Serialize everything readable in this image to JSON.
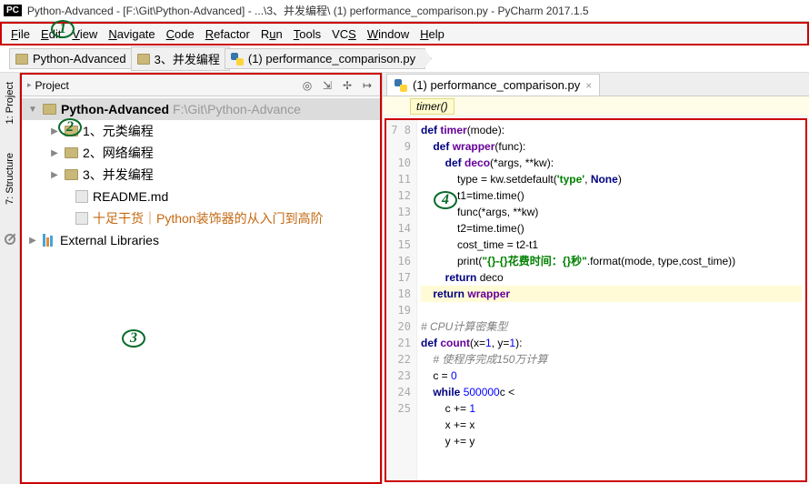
{
  "window": {
    "badge": "PC",
    "title": "Python-Advanced - [F:\\Git\\Python-Advanced] - ...\\3、并发编程\\ (1) performance_comparison.py - PyCharm 2017.1.5"
  },
  "menu": {
    "items": [
      {
        "pre": "",
        "u": "F",
        "rest": "ile"
      },
      {
        "pre": "",
        "u": "E",
        "rest": "dit"
      },
      {
        "pre": "",
        "u": "V",
        "rest": "iew"
      },
      {
        "pre": "",
        "u": "N",
        "rest": "avigate"
      },
      {
        "pre": "",
        "u": "C",
        "rest": "ode"
      },
      {
        "pre": "",
        "u": "R",
        "rest": "efactor"
      },
      {
        "pre": "R",
        "u": "u",
        "rest": "n"
      },
      {
        "pre": "",
        "u": "T",
        "rest": "ools"
      },
      {
        "pre": "VC",
        "u": "S",
        "rest": ""
      },
      {
        "pre": "",
        "u": "W",
        "rest": "indow"
      },
      {
        "pre": "",
        "u": "H",
        "rest": "elp"
      }
    ]
  },
  "breadcrumb": [
    {
      "type": "folder",
      "text": "Python-Advanced"
    },
    {
      "type": "folder",
      "text": "3、并发编程"
    },
    {
      "type": "py",
      "text": "(1) performance_comparison.py"
    }
  ],
  "side_tabs": {
    "project": "1: Project",
    "structure": "7: Structure"
  },
  "project_header": {
    "title": "Project"
  },
  "tree": {
    "root": {
      "name": "Python-Advanced",
      "path": "F:\\Git\\Python-Advance"
    },
    "children": [
      {
        "type": "folder",
        "name": "1、元类编程"
      },
      {
        "type": "folder",
        "name": "2、网络编程"
      },
      {
        "type": "folder",
        "name": "3、并发编程"
      },
      {
        "type": "file",
        "name": "README.md"
      },
      {
        "type": "file",
        "name": "十足干货｜Python装饰器的从入门到高阶",
        "orange": true
      }
    ],
    "external": "External Libraries"
  },
  "editor": {
    "tab": {
      "name": "(1) performance_comparison.py"
    },
    "crumb": "timer()",
    "gutter_start": 7,
    "gutter_end": 25
  },
  "code_lines": [
    {
      "t": "def ",
      "cls": "kw",
      "a": "timer",
      "b": "(mode):"
    },
    {
      "indent": 1,
      "t": "def ",
      "cls": "kw",
      "a": "wrapper",
      "b": "(func):"
    },
    {
      "indent": 2,
      "t": "def ",
      "cls": "kw",
      "a": "deco",
      "b": "(*args, **kw):"
    },
    {
      "indent": 3,
      "plain": "type = kw.setdefault(",
      "str": "'type'",
      "plain2": ", ",
      "kw2": "None",
      "plain3": ")"
    },
    {
      "indent": 3,
      "plain": "t1=time.time()"
    },
    {
      "indent": 3,
      "plain": "func(*args, **kw)"
    },
    {
      "indent": 3,
      "plain": "t2=time.time()"
    },
    {
      "indent": 3,
      "plain": "cost_time = t2-t1"
    },
    {
      "indent": 3,
      "plain": "print(",
      "str": "\"{}-{}花费时间：{}秒\"",
      "plain2": ".format(mode, type,cost_time))"
    },
    {
      "indent": 2,
      "t": "return ",
      "cls": "kw",
      "plain": "deco"
    },
    {
      "hl": true,
      "indent": 1,
      "t": "return ",
      "cls": "kw",
      "a": "wrapper"
    },
    {
      "blank": true
    },
    {
      "cm": "# CPU计算密集型"
    },
    {
      "t": "def ",
      "cls": "kw",
      "a": "count",
      "b": "(x=",
      "num": "1",
      "b2": ", y=",
      "num2": "1",
      "b3": "):"
    },
    {
      "indent": 1,
      "cm": "# 使程序完成150万计算"
    },
    {
      "indent": 1,
      "plain": "c = ",
      "num": "0"
    },
    {
      "indent": 1,
      "t": "while ",
      "cls": "kw",
      "plain": "c < ",
      "num": "500000",
      "plain2": ":"
    },
    {
      "indent": 2,
      "plain": "c += ",
      "num": "1"
    },
    {
      "indent": 2,
      "plain": "x += x"
    },
    {
      "indent": 2,
      "plain": "y += y"
    }
  ],
  "annotations": {
    "1": "1",
    "2": "2",
    "3": "3",
    "4": "4"
  }
}
